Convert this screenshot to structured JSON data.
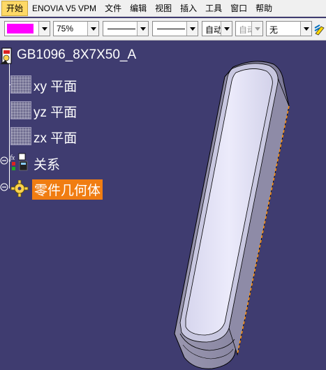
{
  "menubar": {
    "items": [
      {
        "label": "开始"
      },
      {
        "label": "ENOVIA V5 VPM"
      },
      {
        "label": "文件"
      },
      {
        "label": "编辑"
      },
      {
        "label": "视图"
      },
      {
        "label": "插入"
      },
      {
        "label": "工具"
      },
      {
        "label": "窗口"
      },
      {
        "label": "帮助"
      }
    ]
  },
  "toolbar": {
    "color": "#ff00ff",
    "transparency": "75%",
    "thickness": "",
    "linetype": "",
    "layer_1": "自动",
    "layer_2": "自动",
    "render": "无"
  },
  "tree": {
    "root": "GB1096_8X7X50_A",
    "items": [
      {
        "label": "xy 平面",
        "icon": "plane-icon"
      },
      {
        "label": "yz 平面",
        "icon": "plane-icon"
      },
      {
        "label": "zx 平面",
        "icon": "plane-icon"
      },
      {
        "label": "关系",
        "icon": "relations-icon"
      },
      {
        "label": "零件几何体",
        "icon": "gear-icon",
        "selected": true
      }
    ]
  },
  "colors": {
    "background": "#3f3c70",
    "selection": "#f07d12",
    "part_face": "#e6e6fa",
    "part_edge": "#ff8c00"
  }
}
